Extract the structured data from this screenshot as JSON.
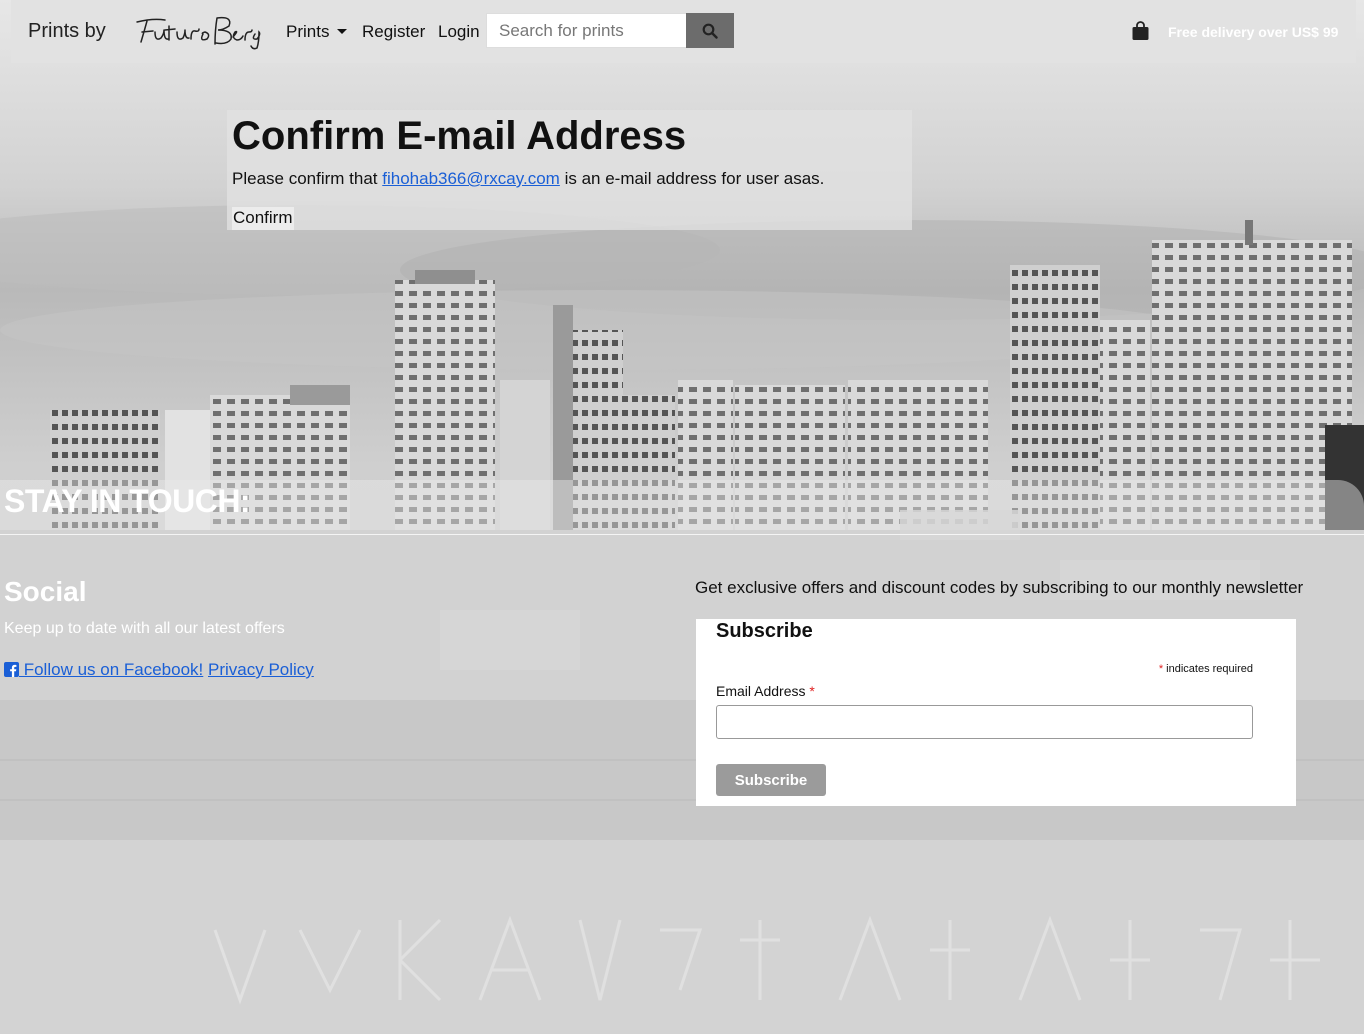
{
  "header": {
    "brand_text": "Prints by",
    "logo_text": "Futuro Berg",
    "nav": {
      "prints": "Prints",
      "register": "Register",
      "login": "Login"
    },
    "search_placeholder": "Search for prints",
    "search_icon": "search-icon",
    "cart_icon": "shopping-bag-icon",
    "delivery_text": "Free delivery over US$ 99"
  },
  "confirm": {
    "title": "Confirm E-mail Address",
    "text_before": "Please confirm that ",
    "email": "fihohab366@rxcay.com",
    "text_after": " is an e-mail address for user asas.",
    "button": "Confirm"
  },
  "footer": {
    "stay_title": "STAY IN TOUCH:",
    "social_title": "Social",
    "social_text": "Keep up to date with all our latest offers",
    "facebook_link": " Follow us on Facebook!",
    "facebook_icon": "facebook-square-icon",
    "privacy_link": "Privacy Policy",
    "newsletter_text": "Get exclusive offers and discount codes by subscribing to our monthly newsletter",
    "subscribe": {
      "title": "Subscribe",
      "required_star": "*",
      "required_note": " indicates required",
      "email_label": "Email Address",
      "button": "Subscribe"
    }
  },
  "colors": {
    "link": "#1a5fd6",
    "required": "#e02020",
    "search_button": "#6c6c6c",
    "subscribe_button": "#9b9b9b"
  }
}
